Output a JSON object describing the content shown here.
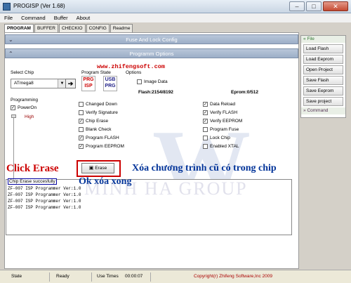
{
  "window": {
    "title": "PROGISP (Ver 1.68)"
  },
  "menu": [
    "File",
    "Command",
    "Buffer",
    "About"
  ],
  "tabs": [
    "PROGRAM",
    "BUFFER",
    "CHECKIO",
    "CONFIG",
    "Readme"
  ],
  "sections": {
    "fuse": "Fuse And Lock Config",
    "options": "Programm Options"
  },
  "url": "www.zhifengsoft.com",
  "chip": {
    "label": "Select Chip",
    "value": "ATmega8"
  },
  "program_state": {
    "label": "Program State",
    "logo1": "PRG ISP",
    "logo2": "USB PRG"
  },
  "options_label": "Options",
  "image_data": "Image Data",
  "flash": "Flash:2154/8192",
  "eprom": "Eprom:0/512",
  "programming": {
    "label": "Programming",
    "poweron": "PowerOn",
    "high": "High"
  },
  "checkboxes_mid": [
    {
      "label": "Changed Down",
      "checked": false
    },
    {
      "label": "Verify Signature",
      "checked": false
    },
    {
      "label": "Chip Erase",
      "checked": true
    },
    {
      "label": "Blank Check",
      "checked": false
    },
    {
      "label": "Program FLASH",
      "checked": true
    },
    {
      "label": "Program EEPROM",
      "checked": true
    }
  ],
  "checkboxes_right": [
    {
      "label": "Data Reload",
      "checked": true
    },
    {
      "label": "Verify FLASH",
      "checked": true
    },
    {
      "label": "Verify EEPROM",
      "checked": true
    },
    {
      "label": "Program Fuse",
      "checked": false
    },
    {
      "label": "Lock Chip",
      "checked": false
    },
    {
      "label": "Enabled XTAL",
      "checked": false
    }
  ],
  "erase_label": "Erase",
  "annotations": {
    "click": "Click Erase",
    "ok": "Ok xóa xong",
    "xoa": "Xóa chương trình cũ có trong chip"
  },
  "watermark": {
    "logo": "W",
    "text": "MINH HA GROUP"
  },
  "log": [
    "Chip Erase succesfully",
    "ZF-007 ISP Programmer Ver:1.0",
    "ZF-007 ISP Programmer Ver:1.0",
    "ZF-007 ISP Programmer Ver:1.0",
    "ZF-007 ISP Programmer Ver:1.0"
  ],
  "side": {
    "file_head": "File",
    "buttons": [
      "Load Flash",
      "Load Eeprom",
      "Open Project",
      "Save Flash",
      "Save Eeprom",
      "Save project"
    ],
    "command_head": "Command"
  },
  "status": {
    "state_label": "State",
    "state_value": "Ready",
    "time_label": "Use Times",
    "time_value": "00:00:07",
    "copyright": "Copyright(r) Zhifeng Software,Inc 2009"
  }
}
